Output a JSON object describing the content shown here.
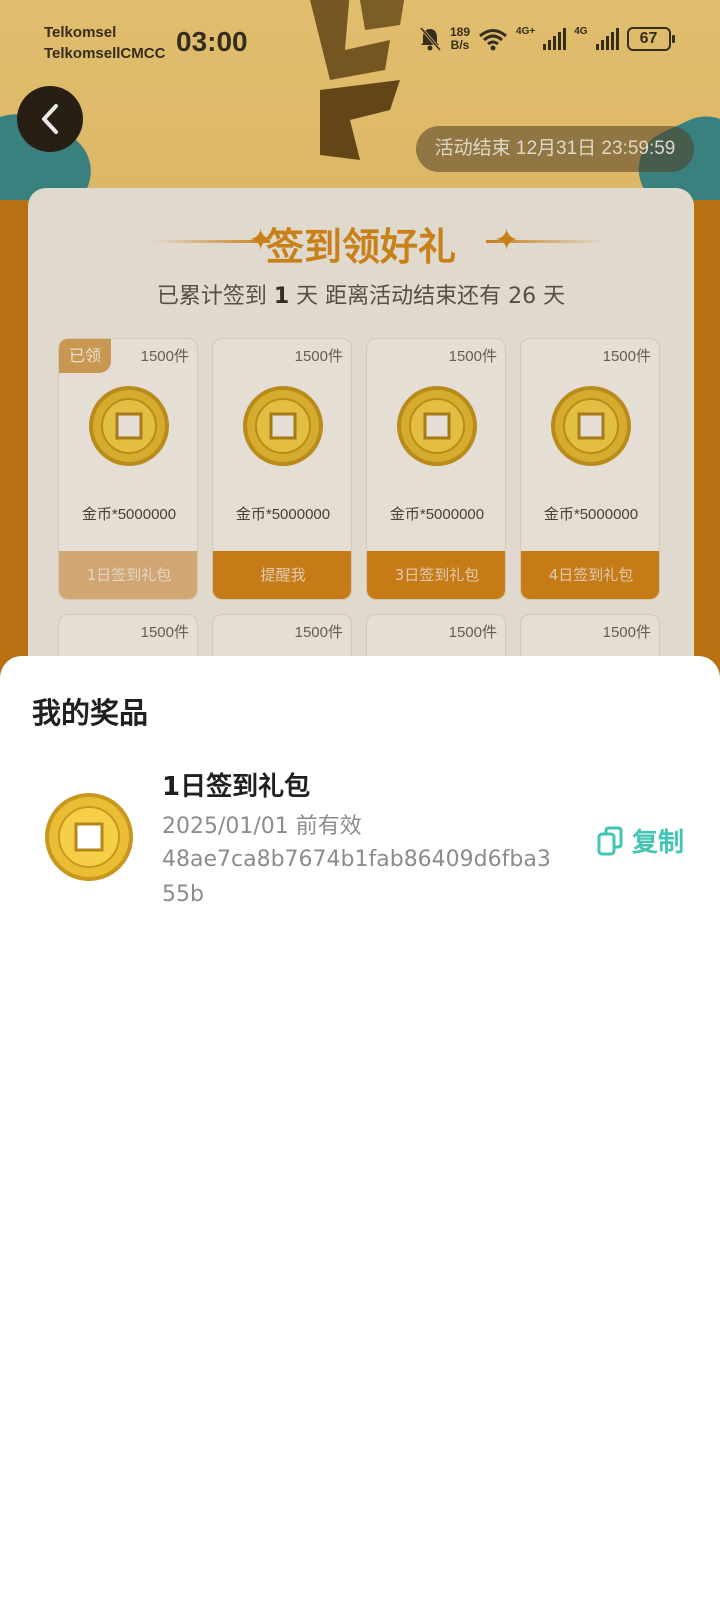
{
  "status_bar": {
    "carrier1": "Telkomsel",
    "carrier2": "TelkomsellCMCC",
    "time": "03:00",
    "speed_value": "189",
    "speed_unit": "B/s",
    "net1": "4G+",
    "net2": "4G",
    "battery": "67"
  },
  "header": {
    "back_icon": "chevron-left-icon",
    "activity_end": "活动结束 12月31日 23:59:59"
  },
  "card": {
    "title": "签到领好礼",
    "subtitle_prefix": "已累计签到",
    "days_signed": "1",
    "subtitle_mid": "天  距离活动结束还有",
    "days_left": "26",
    "subtitle_suffix": "天",
    "tiles": [
      {
        "count": "1500件",
        "tag": "已领",
        "reward": "金币*5000000",
        "button": "1日签到礼包"
      },
      {
        "count": "1500件",
        "reward": "金币*5000000",
        "button": "提醒我"
      },
      {
        "count": "1500件",
        "reward": "金币*5000000",
        "button": "3日签到礼包"
      },
      {
        "count": "1500件",
        "reward": "金币*5000000",
        "button": "4日签到礼包"
      },
      {
        "count": "1500件"
      },
      {
        "count": "1500件"
      },
      {
        "count": "1500件"
      },
      {
        "count": "1500件"
      }
    ]
  },
  "sheet": {
    "title": "我的奖品",
    "prize": {
      "name": "1日签到礼包",
      "valid": "2025/01/01 前有效",
      "code": "48ae7ca8b7674b1fab86409d6fba355b",
      "copy_label": "复制",
      "copy_icon": "copy-icon",
      "coin_icon": "gold-coin-icon"
    }
  },
  "colors": {
    "accent": "#d98b1b",
    "copy": "#43c5b4"
  }
}
